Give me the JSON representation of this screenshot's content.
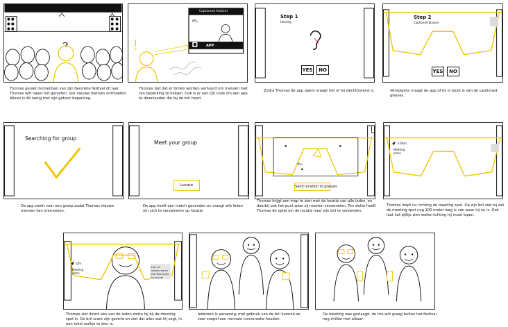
{
  "colors": {
    "accent": "#f2c300",
    "ink": "#111111",
    "grey": "#dcdcdc"
  },
  "panel1": {
    "caption": "Thomas geniet momenteel van zijn favoriete festival dit jaar. Thomas wilt naast het genieten, ook nieuwe mensen ontmoeten. Alleen is dit lastig met zijn gehoor beperking."
  },
  "panel2": {
    "sign_title": "Captioned festival",
    "sign_price": "€5,-",
    "sign_app": "APP",
    "caption": "Thomas ziet dat er brillen worden verhuurd om mensen met zijn beperking te helpen. Ook is er een QR code om een app te downloaden die bij de bril hoort."
  },
  "panel3": {
    "step": "Step 1",
    "step_sub": "Hearing",
    "yes": "YES",
    "no": "NO",
    "caption": "Zodra Thomas de app opent vraagt het of hij slechthorend is."
  },
  "panel4": {
    "step": "Step 2",
    "step_sub": "Captioned glasses",
    "yes": "YES",
    "no": "NO",
    "caption": "Vervolgens vraagt de app of hij in bezit is van de captioned glasses."
  },
  "panel5": {
    "heading": "Searching for group",
    "caption": "De app zoekt voor een groep zodat Thomas nieuwe mensen kan ontmoeten."
  },
  "panel6": {
    "heading": "Meet your group",
    "button": "Locate",
    "caption": "De app heeft een match gevonden en vraagt alle leden om zich te verzamelen op locatie"
  },
  "panel7": {
    "you_label": "You",
    "button": "Send location to glasses",
    "caption": "Thomas krijgt een map te zien met de locatie van alle leden, en daarbij ook het punt waar zij moeten verzamelen. Ten slotte heeft Thomas de optie om de locatie naar zijn bril te verzenden."
  },
  "panel8": {
    "distance": "100m",
    "spot": "Meeting place",
    "caption": "Thomas loopt nu richting de meeting spot. Op zijn bril ziet hij dat de meeting spot nog 100 meter weg is van waar hij nu is. Ook laat het pijltje zien welke richting hij moet lopen."
  },
  "panel9": {
    "distance": "0m",
    "spot": "Meeting place",
    "bubble": "Hey! It seems we're the first ones to arrive!",
    "caption": "Thomas ziet direct één van de leden zodra hij bij de meeting spot is. De bril scant zijn gezicht en ziet dat alles wat hij zegt, in een tekst wolkje te zien is."
  },
  "panel10": {
    "caption": "Iedereen is aanwezig, met gebruik van de bril kunnen ze zeer soepel een normale conversatie houden."
  },
  "panel11": {
    "caption": "De meeting was geslaagd, de trio wilt graag buiten het festival nog chillen met elkaar."
  }
}
